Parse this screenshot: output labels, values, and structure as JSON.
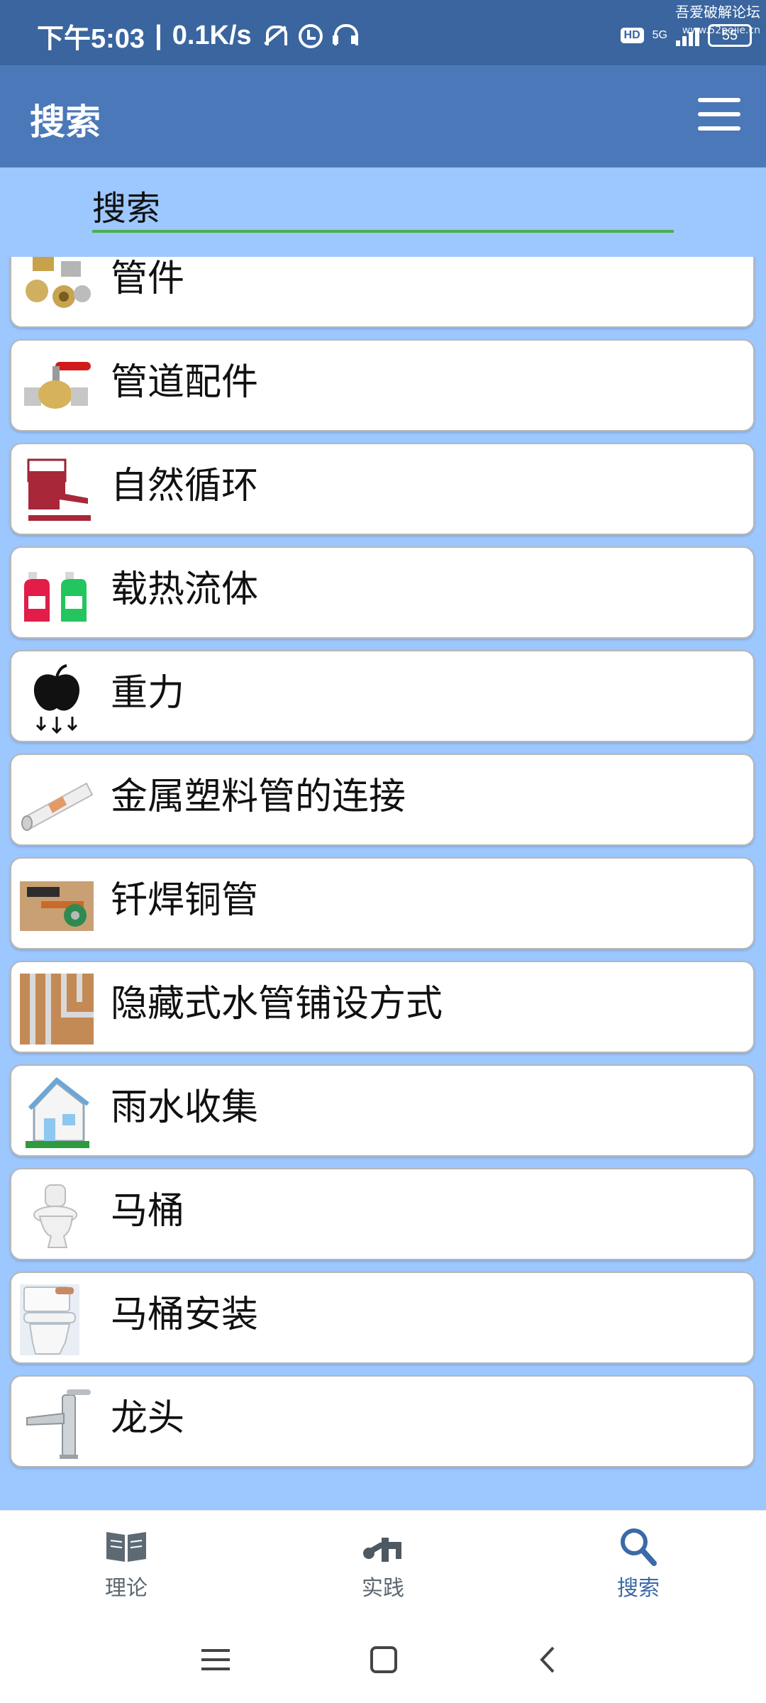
{
  "status_bar": {
    "time": "下午5:03",
    "separator": "|",
    "speed": "0.1K/s",
    "hd": "HD",
    "network": "5G",
    "battery": "55",
    "watermark_line1": "吾爱破解论坛",
    "watermark_line2": "www.52pojie.cn"
  },
  "app_bar": {
    "title": "搜索",
    "menu_icon": "hamburger-menu-icon"
  },
  "search": {
    "placeholder": "搜索",
    "value": ""
  },
  "list": {
    "items": [
      {
        "label": "管件",
        "icon": "pipe-fittings-icon"
      },
      {
        "label": "管道配件",
        "icon": "ball-valve-icon"
      },
      {
        "label": "自然循环",
        "icon": "natural-circulation-icon"
      },
      {
        "label": "载热流体",
        "icon": "coolant-bottles-icon"
      },
      {
        "label": "重力",
        "icon": "apple-gravity-icon"
      },
      {
        "label": "金属塑料管的连接",
        "icon": "metal-plastic-pipe-icon"
      },
      {
        "label": "钎焊铜管",
        "icon": "soldering-copper-pipe-icon"
      },
      {
        "label": "隐藏式水管铺设方式",
        "icon": "concealed-pipes-icon"
      },
      {
        "label": "雨水收集",
        "icon": "rainwater-house-icon"
      },
      {
        "label": "马桶",
        "icon": "toilet-icon"
      },
      {
        "label": "马桶安装",
        "icon": "toilet-installation-icon"
      },
      {
        "label": "龙头",
        "icon": "faucet-icon"
      }
    ]
  },
  "bottom_nav": {
    "items": [
      {
        "label": "理论",
        "icon": "book-icon",
        "active": false
      },
      {
        "label": "实践",
        "icon": "tools-icon",
        "active": false
      },
      {
        "label": "搜索",
        "icon": "search-icon",
        "active": true
      }
    ]
  },
  "colors": {
    "status_bar": "#3a659e",
    "app_bar": "#4a78b8",
    "background": "#9cc7ff",
    "search_underline": "#4caf50",
    "active_nav": "#3b6aa8"
  }
}
